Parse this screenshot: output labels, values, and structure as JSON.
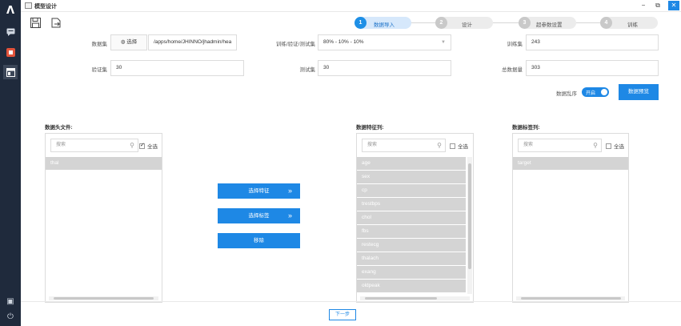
{
  "window": {
    "title": "模型设计",
    "controls": {
      "minimize": "−",
      "restore": "⧉",
      "close": "✕"
    }
  },
  "sidebar": {
    "logo": "Λ",
    "items": [
      {
        "icon": "chat-icon"
      },
      {
        "icon": "app-icon",
        "color": "#e2533b"
      },
      {
        "icon": "window-icon"
      }
    ],
    "bottom": [
      {
        "icon": "monitor-icon",
        "glyph": "▣"
      },
      {
        "icon": "power-icon",
        "glyph": "⏻"
      }
    ]
  },
  "toolbar": {
    "save_icon": "save-icon",
    "export_icon": "export-icon"
  },
  "steps": [
    {
      "num": "1",
      "label": "数据导入",
      "active": true
    },
    {
      "num": "2",
      "label": "设计",
      "active": false
    },
    {
      "num": "3",
      "label": "超参数设置",
      "active": false
    },
    {
      "num": "4",
      "label": "训练",
      "active": false
    }
  ],
  "form": {
    "dataset_label": "数据集",
    "browse_label": "选择",
    "dataset_path": "/apps/home/JHINNO/jhadmin/hea",
    "split_label": "训练/验证/测试集",
    "split_value": "80% - 10% - 10%",
    "train_label": "训练集",
    "train_value": "243",
    "val_label": "验证集",
    "val_value": "30",
    "test_label": "测试集",
    "test_value": "30",
    "total_label": "总数据量",
    "total_value": "303",
    "shuffle_label": "数据乱序",
    "shuffle_state": "开启",
    "preview_label": "数据预览"
  },
  "panels": {
    "header_files": {
      "title": "数据头文件:",
      "search_placeholder": "搜索",
      "select_all": "全选",
      "checked": true,
      "items": [
        "thal"
      ]
    },
    "features": {
      "title": "数据特征列:",
      "search_placeholder": "搜索",
      "select_all": "全选",
      "checked": false,
      "items": [
        "age",
        "sex",
        "cp",
        "trestbps",
        "chol",
        "fbs",
        "restecg",
        "thalach",
        "exang",
        "oldpeak"
      ]
    },
    "labels": {
      "title": "数据标签列:",
      "search_placeholder": "搜索",
      "select_all": "全选",
      "checked": false,
      "items": [
        "target"
      ]
    }
  },
  "actions": {
    "select_feature": "选择特征",
    "select_label": "选择标签",
    "remove": "移除"
  },
  "footer": {
    "next": "下一步"
  }
}
